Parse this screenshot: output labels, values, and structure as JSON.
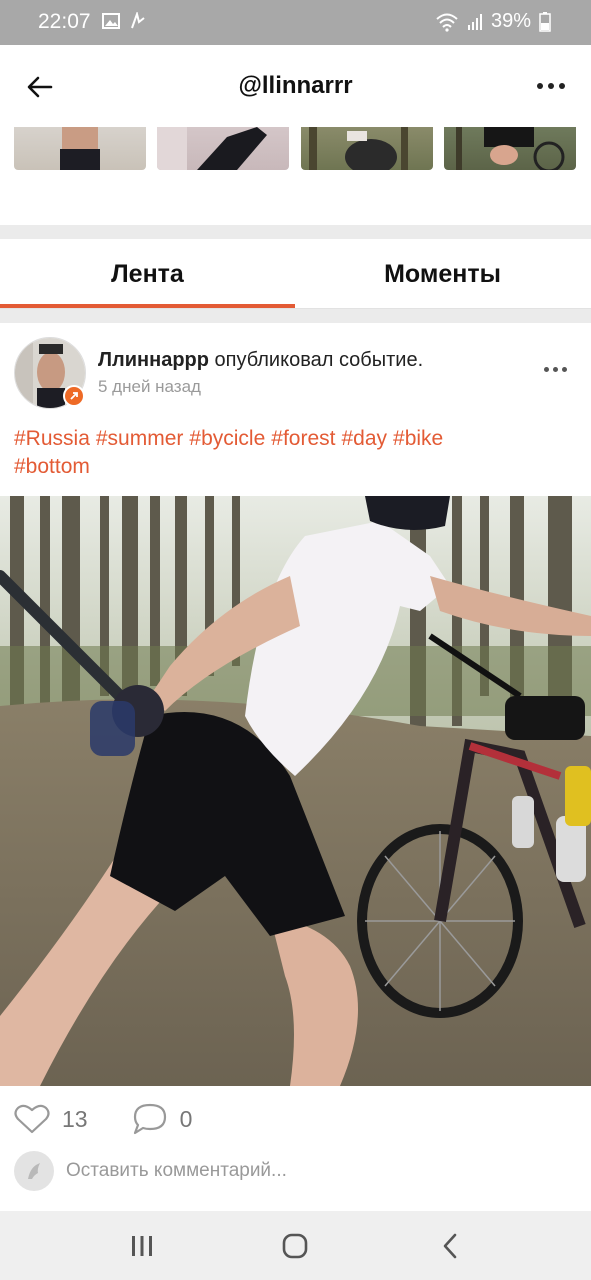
{
  "status_bar": {
    "time": "22:07",
    "battery": "39%"
  },
  "header": {
    "title": "@llinnarrr"
  },
  "tabs": [
    {
      "label": "Лента"
    },
    {
      "label": "Моменты"
    }
  ],
  "post": {
    "author": "Ллиннаррр",
    "action_text": "опубликовал событие.",
    "time": "5 дней назад",
    "hashtags": [
      "#Russia",
      "#summer",
      "#bycicle",
      "#forest",
      "#day",
      "#bike",
      "#bottom"
    ],
    "likes": "13",
    "comments": "0",
    "comment_placeholder": "Оставить комментарий..."
  },
  "colors": {
    "accent": "#e35b35",
    "status_bar": "#a8a8a8"
  },
  "icons": [
    "back-arrow-icon",
    "more-dots-icon",
    "heart-icon",
    "comment-bubble-icon",
    "recents-icon",
    "home-icon",
    "back-nav-icon"
  ]
}
